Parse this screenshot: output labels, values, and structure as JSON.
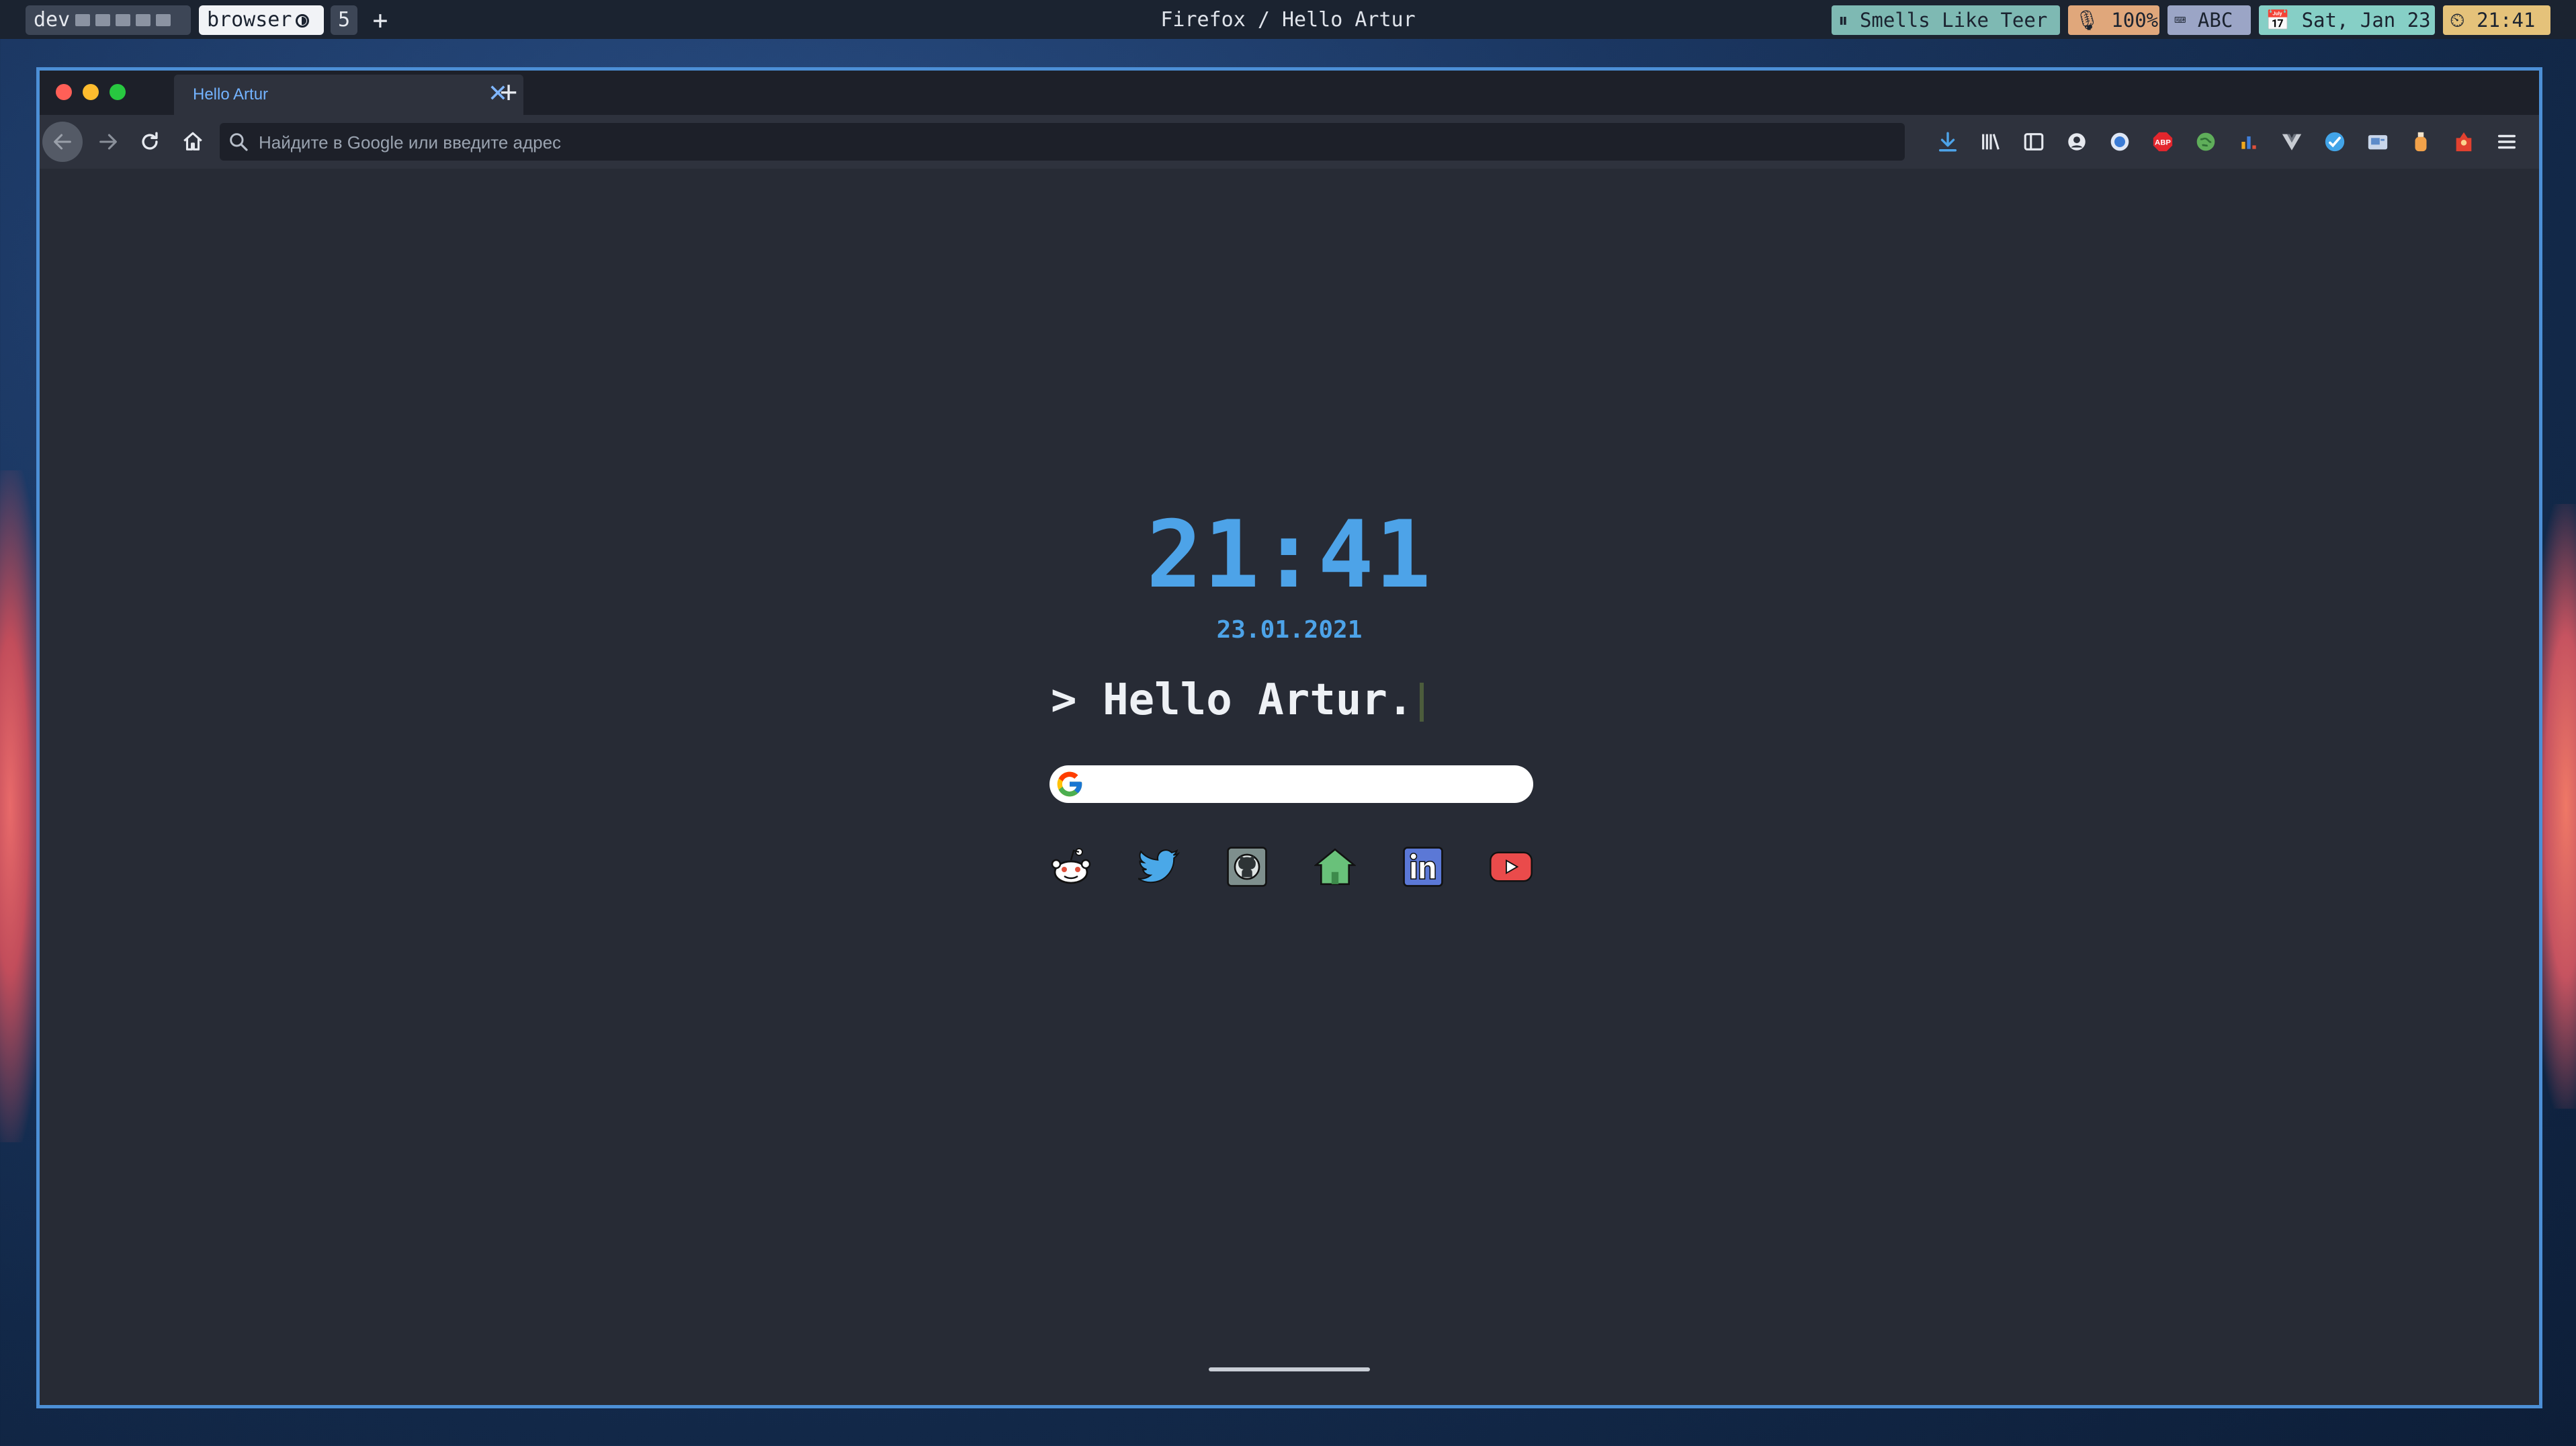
{
  "topbar": {
    "workspace_dev": "dev",
    "workspace_browser": "browser",
    "workspace_count": "5",
    "add_workspace": "+",
    "window_title": "Firefox / Hello Artur",
    "music": "⏸ Smells Like Teer",
    "volume": "🎙 100%",
    "keyboard": "⌨ ABC",
    "date": "📅 Sat, Jan 23",
    "time": "⏲ 21:41",
    "colors": {
      "music": "#7eb9b3",
      "volume": "#e0a77b",
      "keyboard": "#9ba5c6",
      "date": "#86cfc6",
      "time": "#e5c27a"
    }
  },
  "browser": {
    "tab_title": "Hello Artur",
    "tab_close": "✕",
    "new_tab": "+",
    "url_placeholder": "Найдите в Google или введите адрес",
    "toolbar_icons": [
      "download-icon",
      "library-icon",
      "sidebar-icon",
      "account-icon",
      "extension-blue-icon",
      "adblock-icon",
      "extension-globe-icon",
      "extension-chart-icon",
      "vue-devtools-icon",
      "extension-check-icon",
      "extension-image-icon",
      "extension-bottle-icon",
      "extension-fox-icon",
      "menu-icon"
    ],
    "accent": "#4c8fd6"
  },
  "page": {
    "clock": "21:41",
    "date": "23.01.2021",
    "greeting": "> Hello Artur.",
    "search_placeholder": "",
    "links": [
      "reddit-icon",
      "twitter-icon",
      "github-icon",
      "home-icon",
      "linkedin-icon",
      "youtube-icon"
    ],
    "accent": "#4da3e8"
  }
}
